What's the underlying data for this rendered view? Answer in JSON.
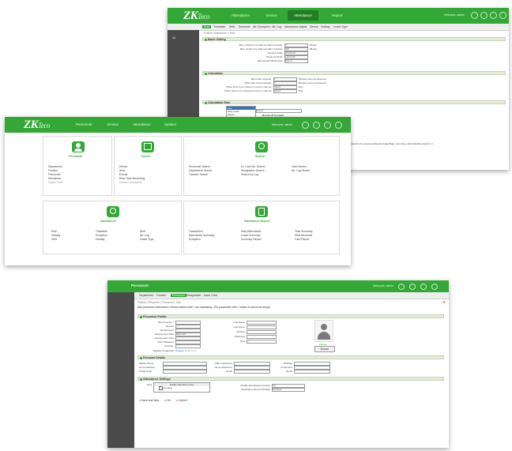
{
  "colors": {
    "brand_green": "#33a836",
    "dark_green": "#1f7f22",
    "sidebar": "#4b4b4b",
    "panel_head": "#e5ecd9"
  },
  "top_window": {
    "logo": "ZK",
    "logo_sub": "Teco",
    "tabs": [
      "Attendance",
      "Device",
      "Attendance",
      "Report"
    ],
    "active_tab_index": 2,
    "user": "Welcome, admin",
    "subtabs": [
      "Rule",
      "Timetable",
      "Shift",
      "Schedule",
      "Att. Exception",
      "Att. Log",
      "Attendance Adjust",
      "Device",
      "Holiday",
      "Leave Type"
    ],
    "active_subtab_index": 0,
    "breadcrumb": "Position: Attendance > Rule",
    "sidebar_label": "Att",
    "panels": {
      "basic": "Basic Setting",
      "calculation": "Calculation",
      "calc_rule": "Calculation Rule"
    },
    "basic_rows": [
      {
        "label": "Max. interval of a valid record(in minutes):",
        "value": "5",
        "unit": "Minute"
      },
      {
        "label": "Max. length of a valid record(in minutes):",
        "value": "720",
        "unit": "Minute"
      },
      {
        "label": "Check-in Rule:",
        "value": "First Punch",
        "unit": ""
      },
      {
        "label": "Check-out Rule:",
        "value": "Last Punch",
        "unit": ""
      },
      {
        "label": "Must Punch Whole Day:",
        "value": "Every 0",
        "unit": ""
      }
    ],
    "calc_rows": [
      {
        "label": "When late exceeds:",
        "value": "0",
        "unit": "Minutes count as absence"
      },
      {
        "label": "When late count exceeds:",
        "value": "0",
        "unit": "Minutes count as absence"
      },
      {
        "label": "When there is no Check-in record, mark as:",
        "value": "Absent",
        "unit": "Day"
      },
      {
        "label": "When there is no Check-out record, mark as:",
        "value": "Absent",
        "unit": "Day"
      }
    ],
    "calc_rule_items": [
      "Late",
      "Early Leave",
      "Absent"
    ],
    "calc_rule_select": "Round",
    "calc_rule_heading": "Round off Counted",
    "notice": "This rule is allowed to be counted. Absence (type=Day), over-time, administrative report (= )"
  },
  "middle_window": {
    "logo": "ZK",
    "logo_sub": "Teco",
    "tabs": [
      "Personnel",
      "Device",
      "Attendance",
      "System"
    ],
    "user": "Welcome, admin",
    "cards": [
      {
        "title": "Personnel",
        "links": [
          "Department",
          "Position",
          "Personnel",
          "Dismission",
          "Import Card"
        ]
      },
      {
        "title": "Device",
        "links": [
          "Device",
          "Area",
          "Events",
          "Real-Time Monitoring",
          "Device Commands"
        ]
      },
      {
        "title": "Search",
        "col1": [
          "Personnel Search",
          "Department Search",
          "Transfer Search"
        ],
        "col2": [
          "Dr. Card No. Search",
          "Resignation Search",
          "Search by Log"
        ],
        "col3": [
          "Card Search",
          "Att. Log Search"
        ]
      },
      {
        "title": "Attendance",
        "col1": [
          "Rule",
          "Holiday",
          "Shift"
        ],
        "col2": [
          "Timetable",
          "Exception",
          "Holiday"
        ],
        "col3": [
          "Shift",
          "Att. Log",
          "Leave Type"
        ]
      },
      {
        "title": "Attendance Report",
        "col1": [
          "Transaction",
          "Attendance Summary",
          "Exception"
        ],
        "col2": [
          "Daily Attendance",
          "Leave Summary",
          "Summary Report"
        ],
        "col3": [
          "Total Summary",
          "Shift Abnormal",
          "Card Report"
        ]
      }
    ]
  },
  "bottom_window": {
    "title": "Personnel",
    "user": "Welcome, admin",
    "subtabs": [
      "Department",
      "Position",
      "Personnel",
      "Resignation",
      "Issue Card"
    ],
    "active_subtab_index": 2,
    "breadcrumb": "Position: Personnel > Personnel > Add",
    "notice": "Add personnel information: Fields marked with * are mandatory. The parameter with * means it cannot be empty.",
    "panels": {
      "profile": "Personnel Profile",
      "details": "Personal Details",
      "attendance": "Attendance Settings"
    },
    "profile_left": [
      {
        "label": "Personnel No.*",
        "value": ""
      },
      {
        "label": "Gender",
        "value": "----"
      },
      {
        "label": "Department*",
        "value": ""
      },
      {
        "label": "Employment Date",
        "value": "2017-1-16"
      },
      {
        "label": "Employment Type",
        "value": ""
      },
      {
        "label": "Card Password",
        "value": ""
      },
      {
        "label": "Card No.",
        "value": ""
      }
    ],
    "profile_right": [
      {
        "label": "First Name",
        "value": ""
      },
      {
        "label": "Last Name",
        "value": ""
      },
      {
        "label": "Number",
        "value": ""
      },
      {
        "label": "Password",
        "value": ""
      },
      {
        "label": "Type",
        "value": "----"
      }
    ],
    "fingerprint_label": "Register Fingerprint",
    "fingerprint_link": "Register",
    "fingerprint_link2": "Read Card",
    "capture_link": "Capture",
    "browse_button": "Browse",
    "details_left": [
      {
        "label": "Mobile Phone",
        "value": ""
      },
      {
        "label": "Home Address",
        "value": ""
      },
      {
        "label": "Postal Code",
        "value": ""
      }
    ],
    "details_mid": [
      {
        "label": "Office Telephone",
        "value": ""
      },
      {
        "label": "Home Telephone",
        "value": ""
      },
      {
        "label": "Email",
        "value": ""
      }
    ],
    "details_right": [
      {
        "label": "Birthday",
        "value": ""
      },
      {
        "label": "ID Number",
        "value": ""
      },
      {
        "label": "Email",
        "value": ""
      }
    ],
    "att_area_label": "Area",
    "att_area_items": [
      "Enable Attendance Area",
      "Any Area"
    ],
    "att_right": [
      {
        "label": "Enable Attendance Function",
        "value": "Yes"
      },
      {
        "label": "Verification Device Privilege",
        "value": "Employee"
      }
    ],
    "actions": [
      "Save and New",
      "OK",
      "Cancel"
    ]
  }
}
